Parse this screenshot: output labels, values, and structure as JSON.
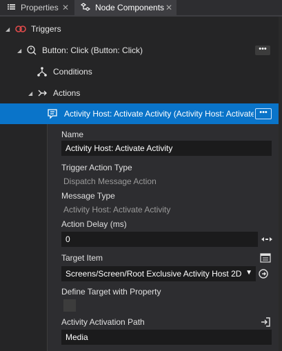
{
  "tabs": [
    {
      "label": "Properties",
      "icon": "list-icon",
      "close": "✕"
    },
    {
      "label": "Node Components",
      "icon": "node-components-icon",
      "close": "✕"
    }
  ],
  "tree": {
    "triggers": {
      "label": "Triggers"
    },
    "button_click": {
      "label": "Button: Click (Button: Click)",
      "more": "•••"
    },
    "conditions": {
      "label": "Conditions"
    },
    "actions": {
      "label": "Actions"
    },
    "activity_host": {
      "label": "Activity Host: Activate Activity (Activity Host: Activate Activity)",
      "more": "•••"
    }
  },
  "properties": {
    "name": {
      "label": "Name",
      "value": "Activity Host: Activate Activity"
    },
    "trigger_action_type": {
      "label": "Trigger Action Type",
      "value": "Dispatch Message Action"
    },
    "message_type": {
      "label": "Message Type",
      "value": "Activity Host: Activate Activity"
    },
    "action_delay": {
      "label": "Action Delay (ms)",
      "value": "0"
    },
    "target_item": {
      "label": "Target Item",
      "value": "Screens/Screen/Root Exclusive Activity Host 2D"
    },
    "define_target": {
      "label": "Define Target with Property",
      "checked": false
    },
    "activation_path": {
      "label": "Activity Activation Path",
      "value": "Media"
    }
  },
  "colors": {
    "selection": "#0a74c9",
    "trigger_icon": "#e04b4b"
  }
}
